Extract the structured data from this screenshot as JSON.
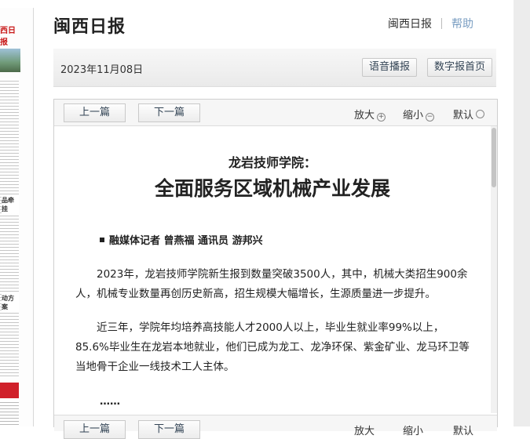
{
  "thumbnail": {
    "masthead": "西日报",
    "headings": [
      "品牵挂",
      "动方案"
    ]
  },
  "header": {
    "site_title": "闽西日报",
    "links": [
      "闽西日报",
      "帮助"
    ]
  },
  "datebar": {
    "date": "2023年11月08日",
    "voice_button": "语音播报",
    "home_button": "数字报首页"
  },
  "toolbar": {
    "prev": "上一篇",
    "next": "下一篇",
    "zoom_in": "放大",
    "zoom_out": "缩小",
    "default": "默认"
  },
  "article": {
    "subtitle": "龙岩技师学院：",
    "title": "全面服务区域机械产业发展",
    "byline": "融媒体记者 曾燕福 通讯员 游邦兴",
    "paragraphs": [
      "2023年，龙岩技师学院新生报到数量突破3500人，其中，机械大类招生900余人，机械专业数量再创历史新高，招生规模大幅增长，生源质量进一步提升。",
      "近三年，学院年均培养高技能人才2000人以上，毕业生就业率99%以上，85.6%毕业生在龙岩本地就业，他们已成为龙工、龙净环保、紫金矿业、龙马环卫等当地骨干企业一线技术工人主体。"
    ],
    "ellipsis": "……"
  },
  "colors": {
    "help_link": "#7a9ec2",
    "masthead_red": "#c81818"
  }
}
